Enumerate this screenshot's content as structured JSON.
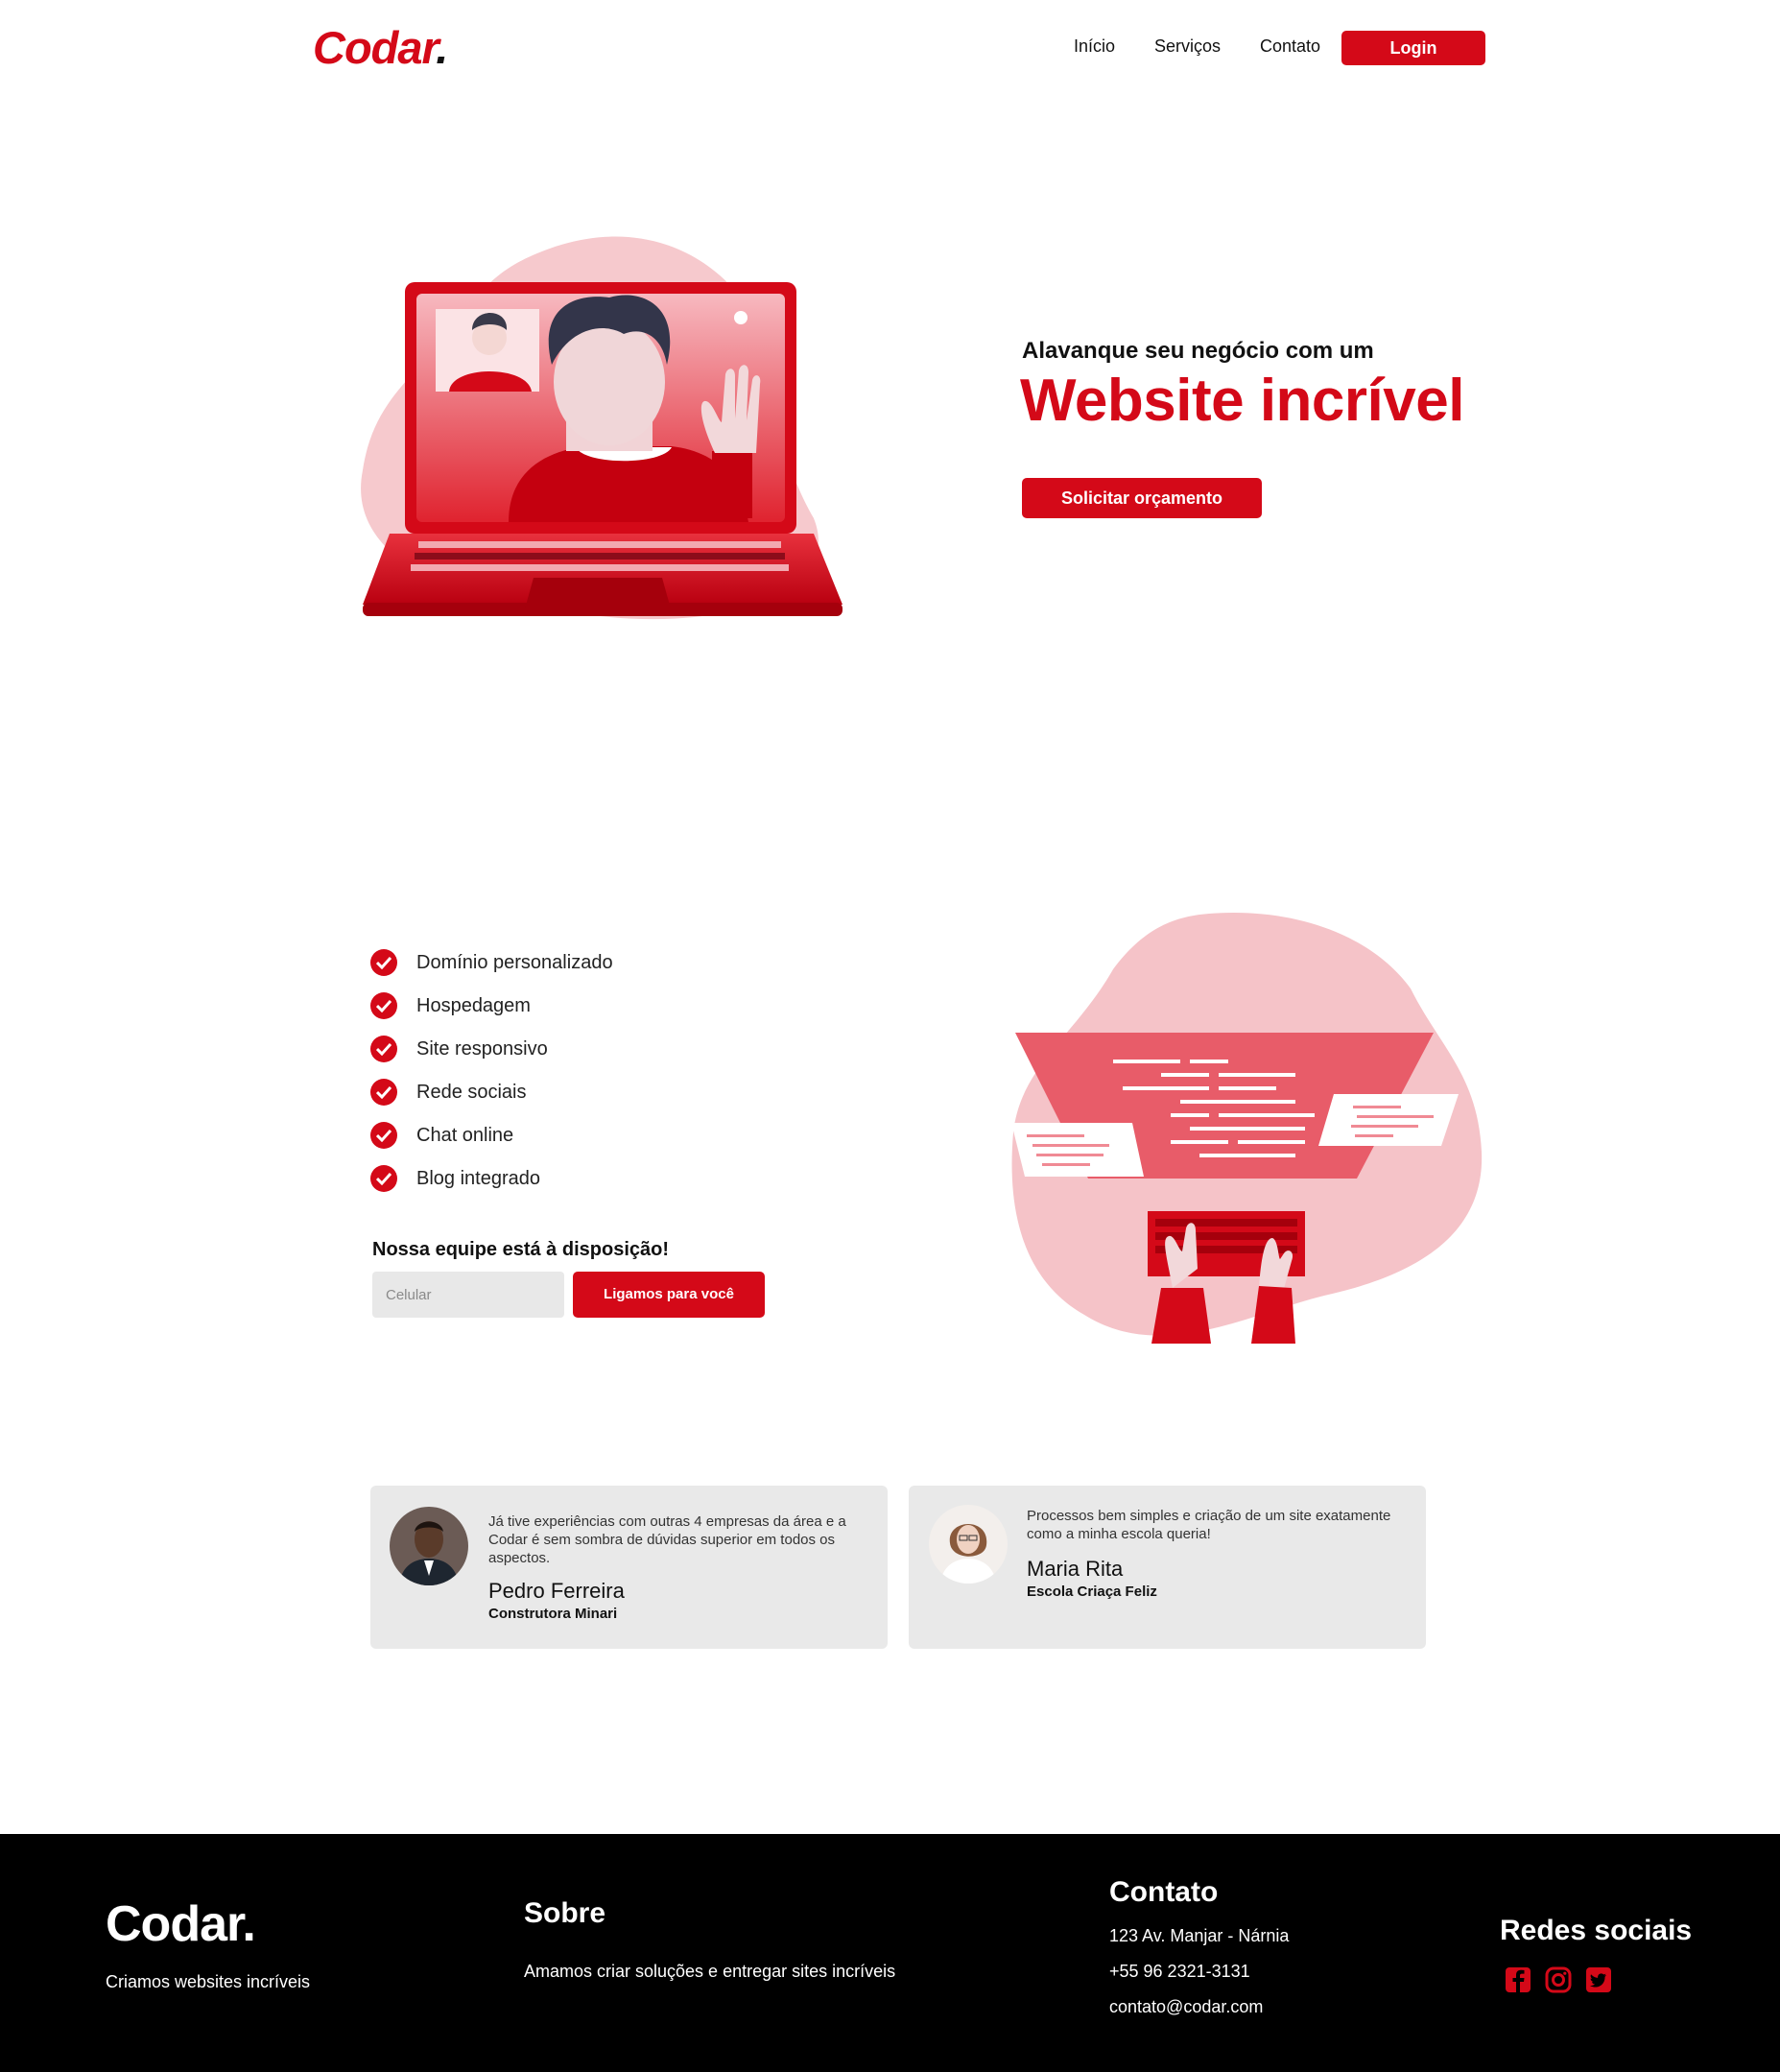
{
  "header": {
    "logo": "Codar",
    "logo_dot": ".",
    "nav": [
      "Início",
      "Serviços",
      "Contato"
    ],
    "login_label": "Login"
  },
  "hero": {
    "subtitle": "Alavanque seu negócio com um",
    "title": "Website incrível",
    "cta_label": "Solicitar orçamento"
  },
  "features": {
    "items": [
      "Domínio personalizado",
      "Hospedagem",
      "Site responsivo",
      "Rede sociais",
      "Chat online",
      "Blog integrado"
    ],
    "team_title": "Nossa equipe está à disposição!",
    "phone_placeholder": "Celular",
    "call_label": "Ligamos para você"
  },
  "testimonials": [
    {
      "text": "Já tive experiências com outras 4 empresas da área e a Codar é sem sombra de dúvidas superior em todos os aspectos.",
      "name": "Pedro Ferreira",
      "company": "Construtora Minari"
    },
    {
      "text": "Processos bem simples e criação de um site exatamente como a minha escola queria!",
      "name": "Maria Rita",
      "company": "Escola Criaça Feliz"
    }
  ],
  "footer": {
    "logo": "Codar.",
    "tagline": "Criamos websites incríveis",
    "about_title": "Sobre",
    "about_text": "Amamos criar soluções e entregar sites incríveis",
    "contact_title": "Contato",
    "address": "123 Av. Manjar - Nárnia",
    "phone": "+55 96 2321-3131",
    "email": "contato@codar.com",
    "social_title": "Redes sociais",
    "social_icons": [
      "facebook-icon",
      "instagram-icon",
      "twitter-icon"
    ]
  },
  "colors": {
    "brand": "#d40918",
    "pink": "#f5c3c8",
    "card_bg": "#e9e9e9",
    "footer_bg": "#000000"
  }
}
